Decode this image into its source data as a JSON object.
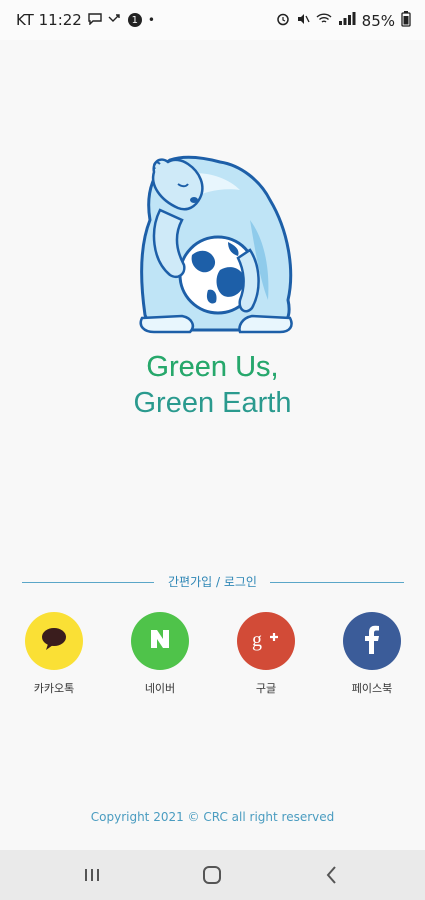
{
  "status_bar": {
    "carrier_time": "KT 11:22",
    "notification_badge": "1",
    "battery": "85%"
  },
  "app": {
    "title_line1": "Green Us,",
    "title_line2": "Green Earth",
    "colors": {
      "brand_green": "#27a86b",
      "brand_blue": "#2b87c5"
    }
  },
  "login": {
    "divider_label": "간편가입 / 로그인",
    "providers": [
      {
        "label": "카카오톡",
        "icon": "speech-bubble-icon",
        "color": "#fae035"
      },
      {
        "label": "네이버",
        "icon": "naver-n-icon",
        "color": "#4fc34a"
      },
      {
        "label": "구글",
        "icon": "google-plus-icon",
        "color": "#d24b37"
      },
      {
        "label": "페이스북",
        "icon": "facebook-f-icon",
        "color": "#3b5c99"
      }
    ]
  },
  "footer": {
    "copyright": "Copyright 2021 © CRC all right reserved"
  },
  "navbar": {
    "buttons": [
      "recent-apps-icon",
      "home-icon",
      "back-icon"
    ]
  }
}
